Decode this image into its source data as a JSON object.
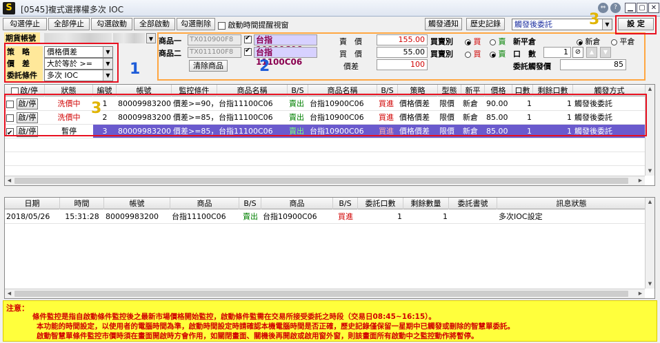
{
  "window": {
    "title": "[0545]複式選擇權多次 IOC",
    "app_icon": "S",
    "circle_buttons": [
      "⇔",
      "?"
    ]
  },
  "toolbar": {
    "buttons": [
      "勾選停止",
      "全部停止",
      "勾選啟動",
      "全部啟動",
      "勾選刪除"
    ],
    "alert_checkbox_label": "啟動時間提醒視窗",
    "trigger_notice": "觸發通知",
    "history": "歷史記錄",
    "trigger_mode": "觸發後委託",
    "settings": "設 定"
  },
  "account": {
    "label_account": "期貨帳號",
    "label_strategy": "策　略",
    "strategy_value": "價格價差",
    "label_spread": "價　差",
    "spread_value": "大於等於 >=",
    "label_condition": "委託條件",
    "condition_value": "多次 IOC"
  },
  "products": {
    "label_1": "商品一",
    "code_1": "TX010900F8",
    "name_1": "台指10900C06",
    "label_2": "商品二",
    "code_2": "TX011100F8",
    "name_2": "台指11100C06",
    "clear_button": "清除商品",
    "price_label": "賣　價",
    "price_1": "155.00",
    "buy_label": "買　價",
    "price_2": "55.00",
    "spread_label": "價差",
    "spread_value": "100",
    "bs_label": "買賣別",
    "buy": "買",
    "sell": "賣",
    "open_close_label": "新平倉",
    "new": "新倉",
    "close": "平倉",
    "qty_label": "口　數",
    "qty_value": "1",
    "trigger_price_label": "委託觸發價",
    "trigger_price_value": "85"
  },
  "strategy_grid": {
    "headers": [
      "啟/停",
      "狀態",
      "編號",
      "帳號",
      "監控條件",
      "商品名稱",
      "B/S",
      "商品名稱",
      "B/S",
      "策略",
      "型態",
      "新平",
      "價格",
      "口數",
      "剩餘口數",
      "觸發方式"
    ],
    "rows": [
      {
        "checked": false,
        "toggle": "啟/停",
        "status": "洗價中",
        "no": "1",
        "account": "80009983200",
        "cond": "價差>=90，台指11100C06",
        "p1": "台指11100C06",
        "bs1": "賣出",
        "p2": "台指10900C06",
        "bs2": "買進",
        "strategy": "價格價差",
        "type": "限價",
        "oc": "新倉",
        "price": "90.00",
        "qty": "1",
        "remain": "1",
        "trigger": "觸發後委託"
      },
      {
        "checked": false,
        "toggle": "啟/停",
        "status": "洗價中",
        "no": "2",
        "account": "80009983200",
        "cond": "價差>=85，台指11100C06",
        "p1": "台指11100C06",
        "bs1": "賣出",
        "p2": "台指10900C06",
        "bs2": "買進",
        "strategy": "價格價差",
        "type": "限價",
        "oc": "新倉",
        "price": "85.00",
        "qty": "1",
        "remain": "1",
        "trigger": "觸發後委託"
      },
      {
        "checked": true,
        "toggle": "啟/停",
        "status": "暫停",
        "no": "3",
        "account": "80009983200",
        "cond": "價差>=85，台指11100C06",
        "p1": "台指11100C06",
        "bs1": "賣出",
        "p2": "台指10900C06",
        "bs2": "買進",
        "strategy": "價格價差",
        "type": "限價",
        "oc": "新倉",
        "price": "85.00",
        "qty": "1",
        "remain": "1",
        "trigger": "觸發後委託"
      }
    ]
  },
  "history_grid": {
    "headers": [
      "日期",
      "時間",
      "帳號",
      "商品",
      "B/S",
      "商品",
      "B/S",
      "委託口數",
      "剩餘數量",
      "委託書號",
      "訊息狀態"
    ],
    "rows": [
      {
        "date": "2018/05/26",
        "time": "15:31:28",
        "account": "80009983200",
        "p1": "台指11100C06",
        "bs1": "賣出",
        "p2": "台指10900C06",
        "bs2": "買進",
        "qty": "1",
        "remain": "1",
        "order_no": "",
        "msg": "多次IOC設定"
      }
    ]
  },
  "notes": {
    "title": "注意：",
    "lines": [
      "條件監控是指自啟動條件監控後之最新市場價格開始監控，啟動條件監需在交易所接受委託之時段（交易日08:45~16:15）。",
      "本功能的時間設定，以使用者的電腦時間為準，啟動時間設定時請確認本機電腦時間是否正確，歷史記錄僅保留一星期中已觸發或刪除的智慧單委託。",
      "啟動智慧單條件監控市價時須在畫面開啟時方會作用，如關閉畫面、關機後再開啟或啟用窗外窗，則該畫面所有啟動中之監控動作將暫停。"
    ]
  },
  "annotations": {
    "box1": "1",
    "box2": "2",
    "box3a": "3",
    "box3b": "3"
  },
  "colors": {
    "red": "#e81020",
    "blue": "#1e5cd8",
    "gold": "#e0b400",
    "select": "#6a5acd"
  }
}
